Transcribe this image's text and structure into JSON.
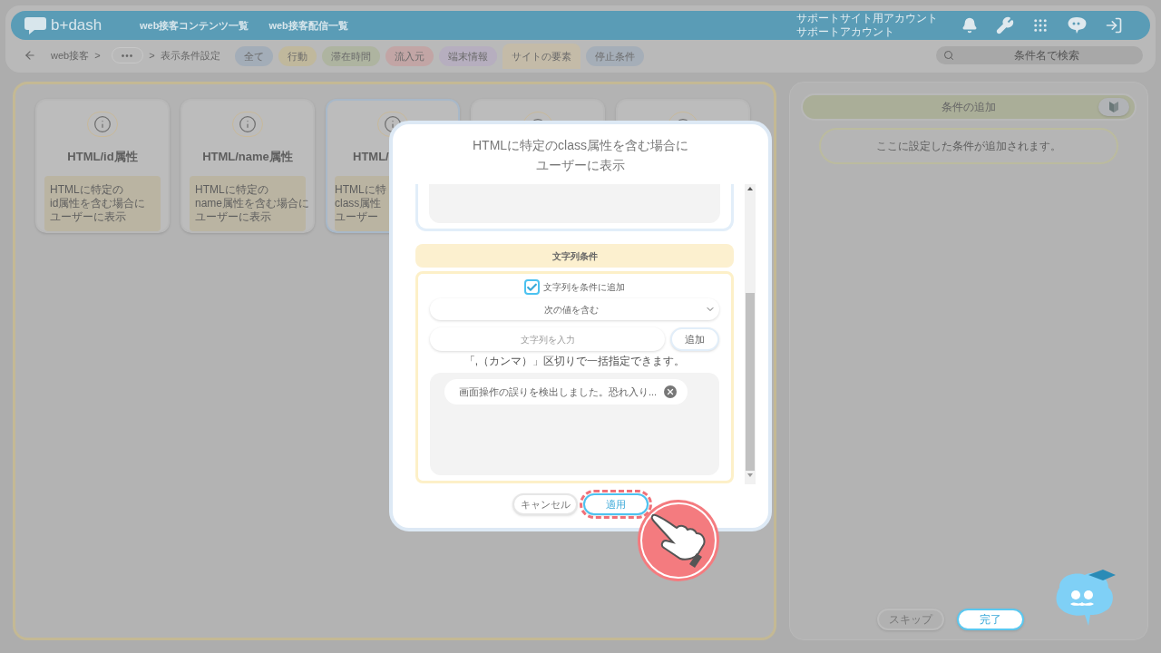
{
  "header": {
    "logo": "b+dash",
    "nav": [
      "web接客コンテンツ一覧",
      "web接客配信一覧"
    ],
    "account": [
      "サポートサイト用アカウント",
      "サポートアカウント"
    ]
  },
  "breadcrumb": {
    "items": [
      "web接客",
      ">",
      "•••",
      ">",
      "表示条件設定"
    ]
  },
  "filters": [
    {
      "label": "全て",
      "color": "#a3adb8",
      "selected": false
    },
    {
      "label": "行動",
      "color": "#c0b89c",
      "selected": false
    },
    {
      "label": "滞在時間",
      "color": "#aeb4a0",
      "selected": false
    },
    {
      "label": "流入元",
      "color": "#c2a5a5",
      "selected": false
    },
    {
      "label": "端末情報",
      "color": "#b6aebf",
      "selected": false
    },
    {
      "label": "サイトの要素",
      "color": "#c4bba8",
      "selected": true
    },
    {
      "label": "停止条件",
      "color": "#a5aeb8",
      "selected": false
    }
  ],
  "search": {
    "placeholder": "条件名で検索"
  },
  "cards": [
    {
      "title": "HTML/id属性",
      "description": [
        "HTMLに特定の",
        "id属性を含む場合に",
        "ユーザーに表示"
      ],
      "selected": false,
      "clipped": false
    },
    {
      "title": "HTML/name属性",
      "description": [
        "HTMLに特定の",
        "name属性を含む場合に",
        "ユーザーに表示"
      ],
      "selected": false,
      "clipped": false
    },
    {
      "title": "HTML/",
      "description": [
        "HTMLに特",
        "class属性",
        "ユーザー"
      ],
      "selected": true,
      "clipped": true
    },
    {
      "selected": false
    },
    {
      "selected": false
    }
  ],
  "dialog": {
    "title": [
      "HTMLに特定のclass属性を含む場合に",
      "ユーザーに表示"
    ],
    "section_title": "文字列条件",
    "checkbox": {
      "label": "文字列を条件に追加",
      "checked": true
    },
    "select": {
      "value": "次の値を含む"
    },
    "input": {
      "placeholder": "文字列を入力"
    },
    "add_button": "追加",
    "hint": "「,（カンマ）」区切りで一括指定できます。",
    "tags": [
      "画面操作の誤りを検出しました。恐れ入り..."
    ],
    "buttons": [
      {
        "label": "キャンセル",
        "highlighted": false
      },
      {
        "label": "適用",
        "highlighted": true
      }
    ]
  },
  "side": {
    "title": "条件の追加",
    "placeholder": "ここに設定した条件が追加されます。",
    "buttons": [
      {
        "label": "スキップ",
        "primary": false
      },
      {
        "label": "完了",
        "primary": true
      }
    ]
  }
}
